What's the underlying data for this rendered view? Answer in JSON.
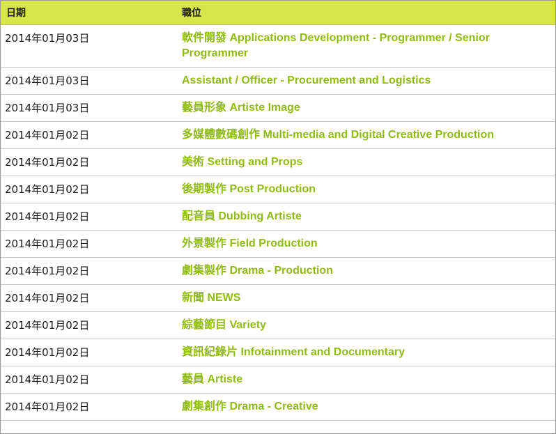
{
  "table": {
    "header": {
      "date": "日期",
      "position": "職位"
    },
    "rows": [
      {
        "date": "2014年01月03日",
        "position": "軟件開發 Applications Development - Programmer / Senior Programmer"
      },
      {
        "date": "2014年01月03日",
        "position": "Assistant / Officer - Procurement and Logistics"
      },
      {
        "date": "2014年01月03日",
        "position": "藝員形象 Artiste Image"
      },
      {
        "date": "2014年01月02日",
        "position": "多媒體數碼創作 Multi-media and Digital Creative Production"
      },
      {
        "date": "2014年01月02日",
        "position": "美術 Setting and Props"
      },
      {
        "date": "2014年01月02日",
        "position": "後期製作 Post Production"
      },
      {
        "date": "2014年01月02日",
        "position": "配音員 Dubbing Artiste"
      },
      {
        "date": "2014年01月02日",
        "position": "外景製作 Field Production"
      },
      {
        "date": "2014年01月02日",
        "position": "劇集製作 Drama - Production"
      },
      {
        "date": "2014年01月02日",
        "position": "新聞 NEWS"
      },
      {
        "date": "2014年01月02日",
        "position": "綜藝節目 Variety"
      },
      {
        "date": "2014年01月02日",
        "position": "資訊紀錄片 Infotainment and Documentary"
      },
      {
        "date": "2014年01月02日",
        "position": "藝員 Artiste"
      },
      {
        "date": "2014年01月02日",
        "position": "劇集創作 Drama - Creative"
      }
    ]
  },
  "colors": {
    "header_bg": "#d6e54a",
    "link": "#8fbb13",
    "row_border": "#c8c8c8"
  }
}
